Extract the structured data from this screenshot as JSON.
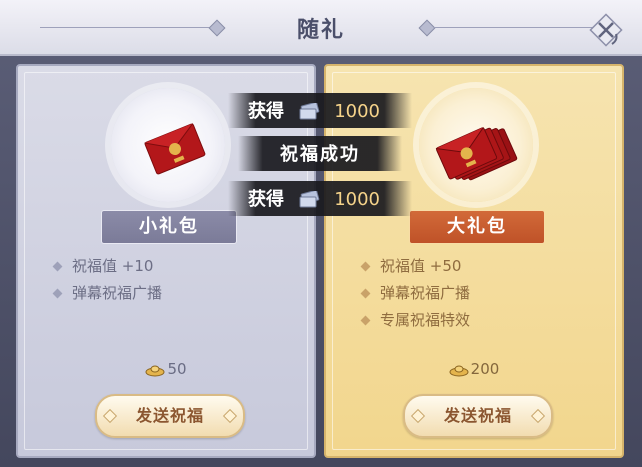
{
  "dialog": {
    "title": "随礼"
  },
  "gifts": [
    {
      "name": "小礼包",
      "features": [
        "祝福值 +10",
        "弹幕祝福广播"
      ],
      "price": "50",
      "button": "发送祝福",
      "icon": "red-envelope-icon"
    },
    {
      "name": "大礼包",
      "features": [
        "祝福值 +50",
        "弹幕祝福广播",
        "专属祝福特效"
      ],
      "price": "200",
      "button": "发送祝福",
      "icon": "red-envelope-stack-icon"
    }
  ],
  "toasts": {
    "gain_label": "获得",
    "gain_top": "1000",
    "gain_bottom": "1000",
    "success": "祝福成功"
  },
  "colors": {
    "small_tag": "#7b7b98",
    "big_tag": "#bf5228",
    "envelope_red": "#b3171a",
    "gold": "#e4b44c"
  }
}
